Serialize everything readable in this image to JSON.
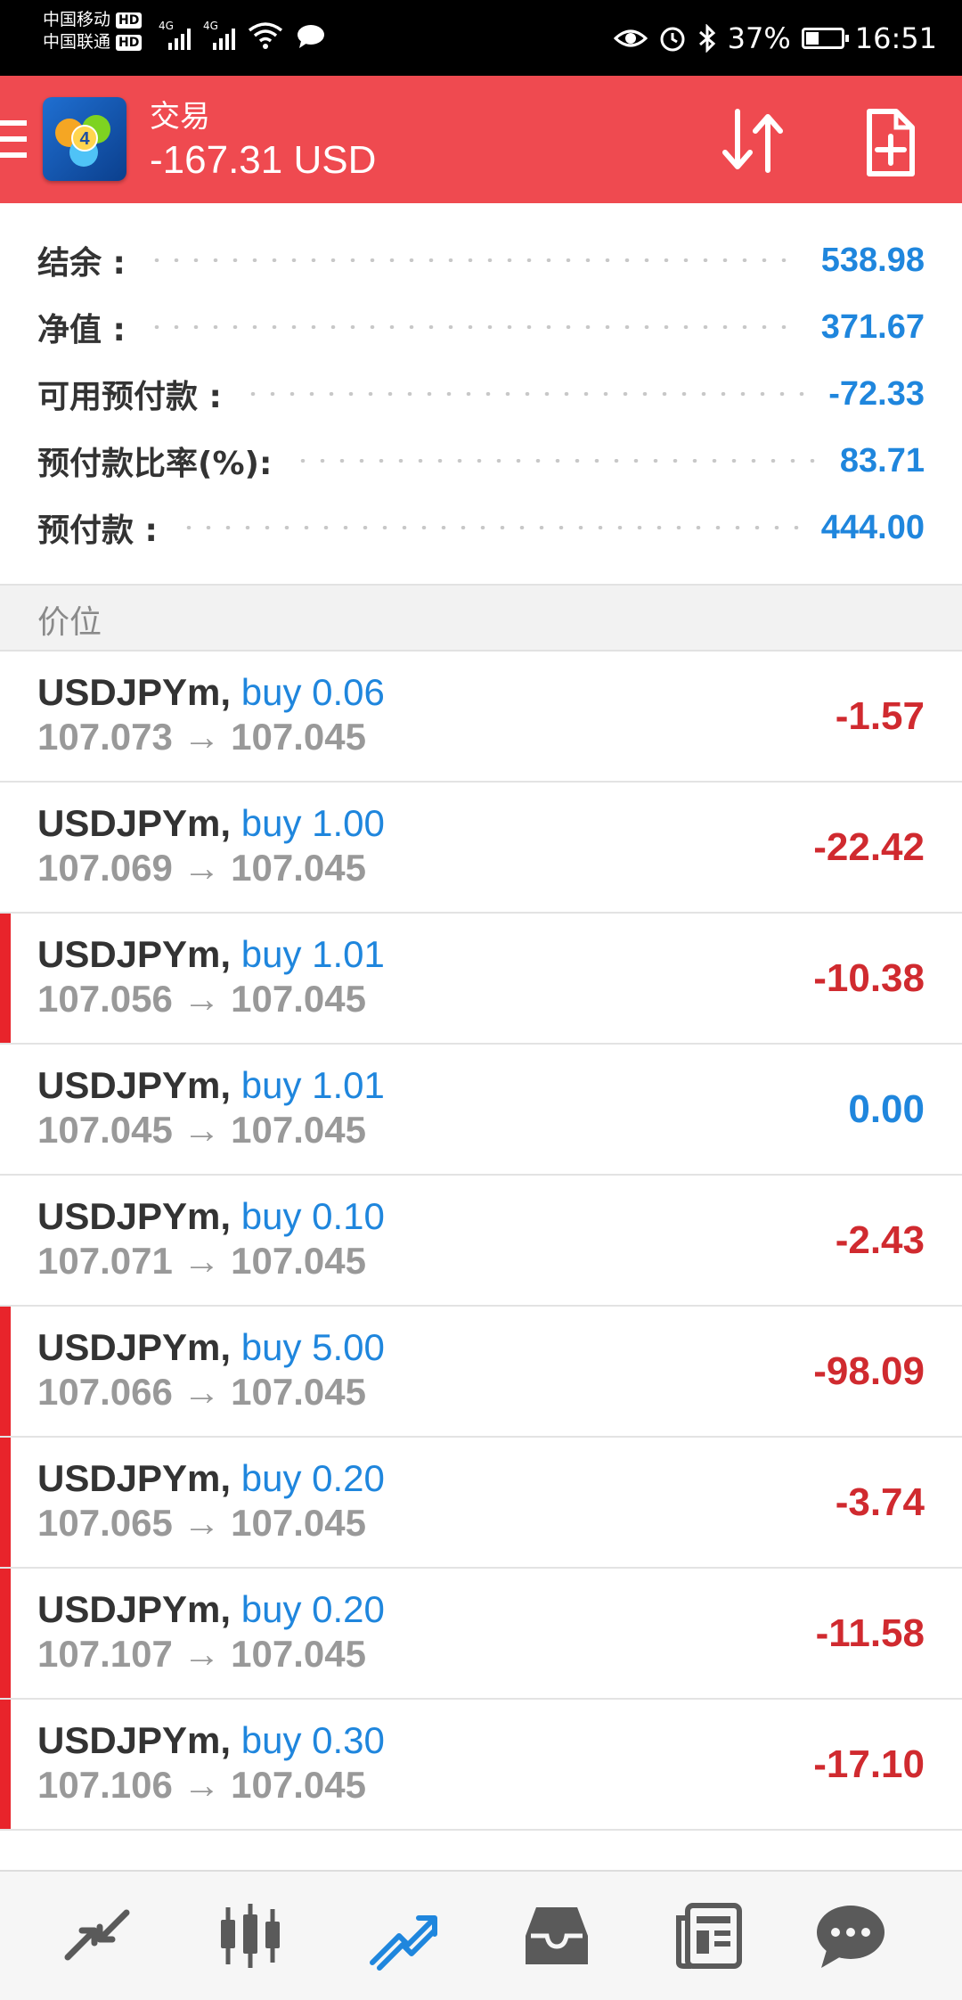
{
  "status_bar": {
    "carrier1": "中国移动",
    "carrier2": "中国联通",
    "hd": "HD",
    "net1": "4G",
    "net2": "4G",
    "battery": "37%",
    "battery_level": 0.37,
    "time": "16:51"
  },
  "header": {
    "title": "交易",
    "balance": "-167.31 USD",
    "logo_text": "4",
    "icons": [
      "menu-icon",
      "sort-icon",
      "new-order-icon"
    ]
  },
  "summary": [
    {
      "label": "结余 :",
      "value": "538.98"
    },
    {
      "label": "净值 :",
      "value": "371.67"
    },
    {
      "label": "可用预付款 :",
      "value": "-72.33"
    },
    {
      "label": "预付款比率(%):",
      "value": "83.71"
    },
    {
      "label": "预付款 :",
      "value": "444.00"
    }
  ],
  "section_title": "价位",
  "trades": [
    {
      "symbol": "USDJPYm,",
      "side": "buy 0.06",
      "prices": "107.073 → 107.045",
      "pl": "-1.57",
      "flag": false
    },
    {
      "symbol": "USDJPYm,",
      "side": "buy 1.00",
      "prices": "107.069 → 107.045",
      "pl": "-22.42",
      "flag": false
    },
    {
      "symbol": "USDJPYm,",
      "side": "buy 1.01",
      "prices": "107.056 → 107.045",
      "pl": "-10.38",
      "flag": true
    },
    {
      "symbol": "USDJPYm,",
      "side": "buy 1.01",
      "prices": "107.045 → 107.045",
      "pl": "0.00",
      "flag": false
    },
    {
      "symbol": "USDJPYm,",
      "side": "buy 0.10",
      "prices": "107.071 → 107.045",
      "pl": "-2.43",
      "flag": false
    },
    {
      "symbol": "USDJPYm,",
      "side": "buy 5.00",
      "prices": "107.066 → 107.045",
      "pl": "-98.09",
      "flag": true
    },
    {
      "symbol": "USDJPYm,",
      "side": "buy 0.20",
      "prices": "107.065 → 107.045",
      "pl": "-3.74",
      "flag": true
    },
    {
      "symbol": "USDJPYm,",
      "side": "buy 0.20",
      "prices": "107.107 → 107.045",
      "pl": "-11.58",
      "flag": true
    },
    {
      "symbol": "USDJPYm,",
      "side": "buy 0.30",
      "prices": "107.106 → 107.045",
      "pl": "-17.10",
      "flag": true
    }
  ],
  "bottom_nav": [
    "quotes-icon",
    "chart-icon",
    "trade-icon",
    "history-icon",
    "news-icon",
    "chat-icon"
  ],
  "colors": {
    "header": "#ef4a50",
    "accent_blue": "#1f86dd",
    "loss_red": "#d02a2f",
    "flag_red": "#e8242b"
  }
}
